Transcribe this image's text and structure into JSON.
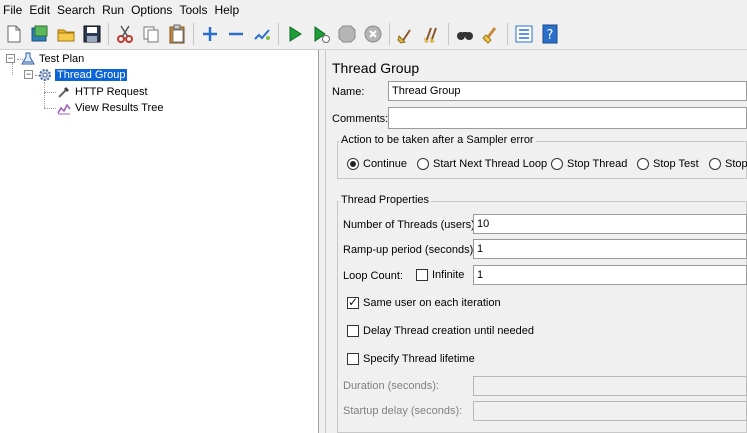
{
  "menu": [
    "File",
    "Edit",
    "Search",
    "Run",
    "Options",
    "Tools",
    "Help"
  ],
  "toolbar": {
    "icons": [
      "new-icon",
      "templates-icon",
      "open-icon",
      "save-icon",
      "cut-icon",
      "copy-icon",
      "paste-icon",
      "expand-icon",
      "collapse-icon",
      "toggle-icon",
      "start-icon",
      "start-no-timers-icon",
      "stop-icon",
      "shutdown-icon",
      "clear-icon",
      "clear-all-icon",
      "search-icon",
      "reset-search-icon",
      "function-helper-icon",
      "help-icon"
    ]
  },
  "tree": {
    "items": [
      {
        "label": "Test Plan"
      },
      {
        "label": "Thread Group"
      },
      {
        "label": "HTTP Request"
      },
      {
        "label": "View Results Tree"
      }
    ]
  },
  "panel": {
    "title": "Thread Group",
    "name_label": "Name:",
    "name_value": "Thread Group",
    "comments_label": "Comments:",
    "comments_value": "",
    "error_action": {
      "legend": "Action to be taken after a Sampler error",
      "options": [
        "Continue",
        "Start Next Thread Loop",
        "Stop Thread",
        "Stop Test",
        "Stop"
      ],
      "selected": "Continue"
    },
    "thread_props": {
      "legend": "Thread Properties",
      "threads_label": "Number of Threads (users):",
      "threads_value": "10",
      "rampup_label": "Ramp-up period (seconds):",
      "rampup_value": "1",
      "loop_label": "Loop Count:",
      "infinite_label": "Infinite",
      "infinite_checked": false,
      "loop_value": "1",
      "same_user_label": "Same user on each iteration",
      "same_user_checked": true,
      "delay_label": "Delay Thread creation until needed",
      "delay_checked": false,
      "lifetime_label": "Specify Thread lifetime",
      "lifetime_checked": false,
      "duration_label": "Duration (seconds):",
      "duration_value": "",
      "startup_label": "Startup delay (seconds):",
      "startup_value": ""
    }
  }
}
